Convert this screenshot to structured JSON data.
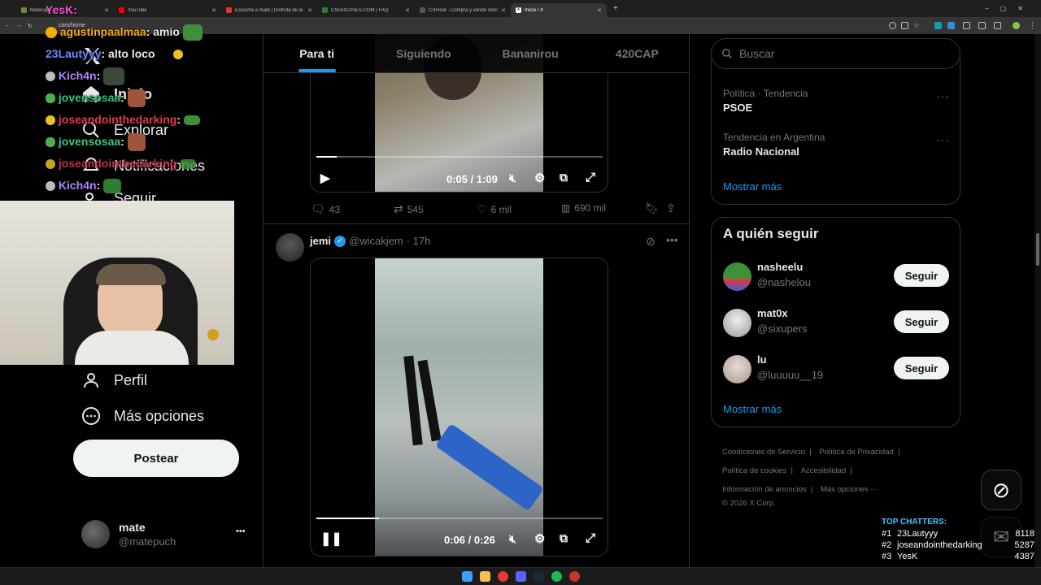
{
  "browser": {
    "tabs": [
      {
        "label": "Matecap",
        "color": "#6a8f3a"
      },
      {
        "label": "YouTube",
        "color": "#ff0000"
      },
      {
        "label": "Escucha a mate | Disfruta de la",
        "color": "#e53935"
      },
      {
        "label": "CSGOCASES.COM | FAQ",
        "color": "#2e7d32"
      },
      {
        "label": "CSFloat - Compra y vende skins",
        "color": "#555555"
      },
      {
        "label": "Inicio / X",
        "color": "#ffffff"
      }
    ],
    "url": "com/home",
    "new_tab": "+"
  },
  "chat": {
    "header_user": "YesK:",
    "messages": [
      {
        "user": "agustinpaalmaa",
        "text": ": amio",
        "color": "#f5a623"
      },
      {
        "user": "23Lautyyy",
        "text": ": alto loco",
        "color": "#6a8cff"
      },
      {
        "user": "Kich4n",
        "text": ":",
        "color": "#b184ff"
      },
      {
        "user": "jovensosaa",
        "text": ":",
        "color": "#36c77a"
      },
      {
        "user": "joseandointhedarking",
        "text": ":",
        "color": "#e53950"
      },
      {
        "user": "jovensosaa",
        "text": ":",
        "color": "#36c77a"
      },
      {
        "user": "joseandointhedarking",
        "text": "",
        "color": "#e53950"
      },
      {
        "user": "Kich4n",
        "text": ":",
        "color": "#b184ff"
      }
    ]
  },
  "sidebar": {
    "items": [
      {
        "label": "Inicio"
      },
      {
        "label": "Explorar"
      },
      {
        "label": "Notificaciones"
      },
      {
        "label": "Seguir"
      },
      {
        "label": "Perfil"
      },
      {
        "label": "Más opciones"
      }
    ],
    "post_button": "Postear",
    "account": {
      "name": "mate",
      "handle": "@matepuch",
      "more": "•••"
    }
  },
  "feed": {
    "tabs": [
      "Para ti",
      "Siguiendo",
      "Bananirou",
      "420CAP"
    ],
    "tweet1": {
      "time": "0:05 / 1:09",
      "progress": 0.07,
      "replies": "43",
      "reposts": "545",
      "likes": "6 mil",
      "views": "690 mil"
    },
    "tweet2": {
      "name": "jemi",
      "handle": "@wicakjem",
      "age": "· 17h",
      "time": "0:06 / 0:26",
      "progress": 0.22
    }
  },
  "right": {
    "search_placeholder": "Buscar",
    "trends": [
      {
        "category": "Política · Tendencia",
        "name": "PSOE"
      },
      {
        "category": "Tendencia en Argentina",
        "name": "Radio Nacional"
      }
    ],
    "trends_more": "Mostrar más",
    "follow_title": "A quién seguir",
    "follow": [
      {
        "name": "nasheelu",
        "handle": "@nashelou",
        "button": "Seguir"
      },
      {
        "name": "mat0x",
        "handle": "@sixupers",
        "button": "Seguir"
      },
      {
        "name": "lu",
        "handle": "@luuuuu__19",
        "button": "Seguir"
      }
    ],
    "follow_more": "Mostrar más",
    "footer": [
      "Condiciones de Servicio",
      "Política de Privacidad",
      "Política de cookies",
      "Accesibilidad",
      "Información de anuncios",
      "Más opciones ···"
    ],
    "copyright": "© 2026 X Corp."
  },
  "overlay": {
    "title": "TOP CHATTERS:",
    "rows": [
      {
        "rank": "#1",
        "name": "23Lautyyy",
        "count": "8118"
      },
      {
        "rank": "#2",
        "name": "joseandointhedarking",
        "count": "5287"
      },
      {
        "rank": "#3",
        "name": "YesK",
        "count": "4387"
      }
    ]
  },
  "colors": {
    "accent": "#1d9bf0",
    "verified": "#1d9bf0",
    "overlay_title": "#3ec9ff"
  }
}
